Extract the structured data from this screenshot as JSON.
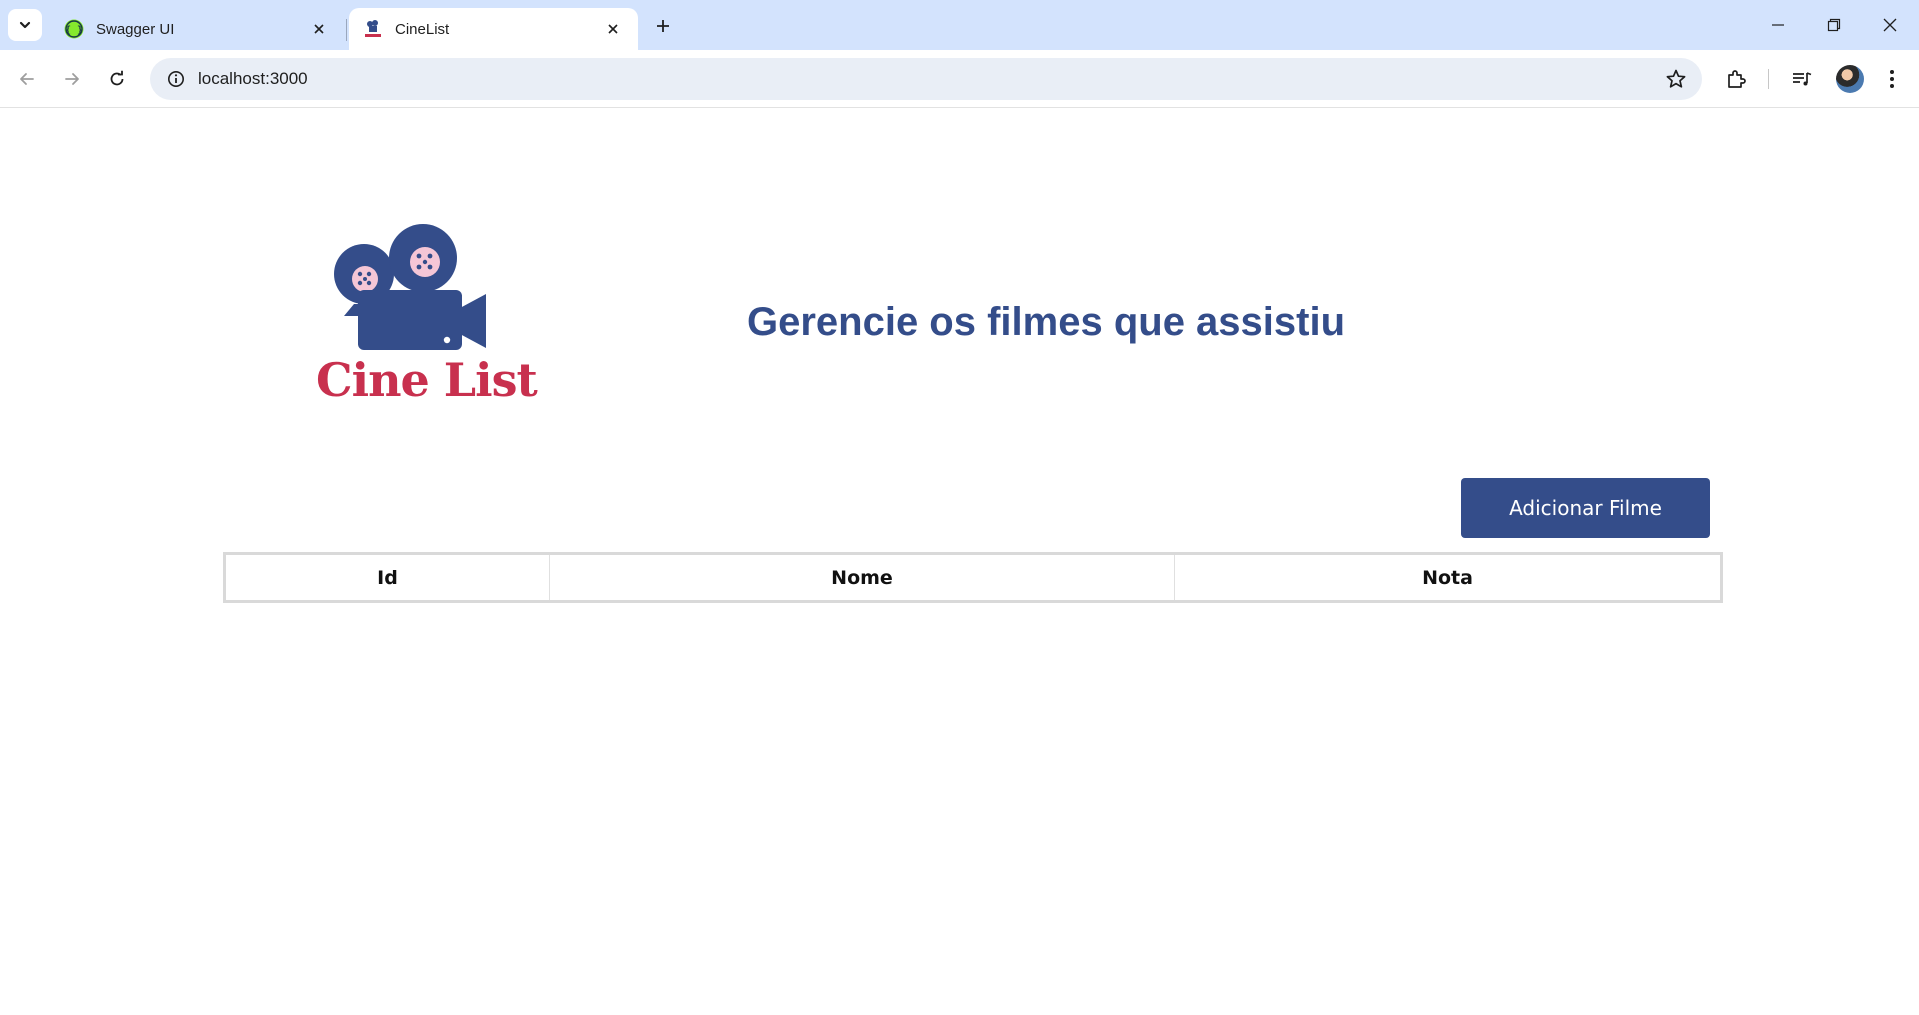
{
  "browser": {
    "tabs": [
      {
        "title": "Swagger UI",
        "active": false,
        "icon": "swagger-icon"
      },
      {
        "title": "CineList",
        "active": true,
        "icon": "cinelist-favicon"
      }
    ],
    "address": "localhost:3000"
  },
  "page": {
    "logo_text": "Cine List",
    "headline": "Gerencie os filmes que assistiu",
    "add_button_label": "Adicionar Filme",
    "table": {
      "columns": [
        "Id",
        "Nome",
        "Nota"
      ],
      "rows": []
    }
  },
  "colors": {
    "brand_blue": "#344d8a",
    "brand_red": "#c8304e",
    "reel_pink": "#f5c6d6"
  }
}
